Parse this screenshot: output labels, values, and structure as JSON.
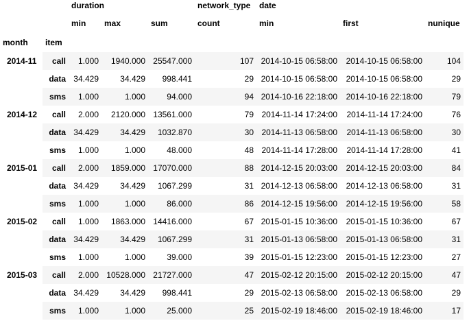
{
  "header": {
    "group1": [
      "duration",
      "network_type",
      "date"
    ],
    "group2": [
      "min",
      "max",
      "sum",
      "count",
      "min",
      "first",
      "nunique"
    ],
    "index_names": [
      "month",
      "item"
    ]
  },
  "rows": [
    {
      "month": "2014-11",
      "items": [
        {
          "item": "call",
          "cells": [
            "1.000",
            "1940.000",
            "25547.000",
            "107",
            "2014-10-15 06:58:00",
            "2014-10-15 06:58:00",
            "104"
          ]
        },
        {
          "item": "data",
          "cells": [
            "34.429",
            "34.429",
            "998.441",
            "29",
            "2014-10-15 06:58:00",
            "2014-10-15 06:58:00",
            "29"
          ]
        },
        {
          "item": "sms",
          "cells": [
            "1.000",
            "1.000",
            "94.000",
            "94",
            "2014-10-16 22:18:00",
            "2014-10-16 22:18:00",
            "79"
          ]
        }
      ]
    },
    {
      "month": "2014-12",
      "items": [
        {
          "item": "call",
          "cells": [
            "2.000",
            "2120.000",
            "13561.000",
            "79",
            "2014-11-14 17:24:00",
            "2014-11-14 17:24:00",
            "76"
          ]
        },
        {
          "item": "data",
          "cells": [
            "34.429",
            "34.429",
            "1032.870",
            "30",
            "2014-11-13 06:58:00",
            "2014-11-13 06:58:00",
            "30"
          ]
        },
        {
          "item": "sms",
          "cells": [
            "1.000",
            "1.000",
            "48.000",
            "48",
            "2014-11-14 17:28:00",
            "2014-11-14 17:28:00",
            "41"
          ]
        }
      ]
    },
    {
      "month": "2015-01",
      "items": [
        {
          "item": "call",
          "cells": [
            "2.000",
            "1859.000",
            "17070.000",
            "88",
            "2014-12-15 20:03:00",
            "2014-12-15 20:03:00",
            "84"
          ]
        },
        {
          "item": "data",
          "cells": [
            "34.429",
            "34.429",
            "1067.299",
            "31",
            "2014-12-13 06:58:00",
            "2014-12-13 06:58:00",
            "31"
          ]
        },
        {
          "item": "sms",
          "cells": [
            "1.000",
            "1.000",
            "86.000",
            "86",
            "2014-12-15 19:56:00",
            "2014-12-15 19:56:00",
            "58"
          ]
        }
      ]
    },
    {
      "month": "2015-02",
      "items": [
        {
          "item": "call",
          "cells": [
            "1.000",
            "1863.000",
            "14416.000",
            "67",
            "2015-01-15 10:36:00",
            "2015-01-15 10:36:00",
            "67"
          ]
        },
        {
          "item": "data",
          "cells": [
            "34.429",
            "34.429",
            "1067.299",
            "31",
            "2015-01-13 06:58:00",
            "2015-01-13 06:58:00",
            "31"
          ]
        },
        {
          "item": "sms",
          "cells": [
            "1.000",
            "1.000",
            "39.000",
            "39",
            "2015-01-15 12:23:00",
            "2015-01-15 12:23:00",
            "27"
          ]
        }
      ]
    },
    {
      "month": "2015-03",
      "items": [
        {
          "item": "call",
          "cells": [
            "2.000",
            "10528.000",
            "21727.000",
            "47",
            "2015-02-12 20:15:00",
            "2015-02-12 20:15:00",
            "47"
          ]
        },
        {
          "item": "data",
          "cells": [
            "34.429",
            "34.429",
            "998.441",
            "29",
            "2015-02-13 06:58:00",
            "2015-02-13 06:58:00",
            "29"
          ]
        },
        {
          "item": "sms",
          "cells": [
            "1.000",
            "1.000",
            "25.000",
            "25",
            "2015-02-19 18:46:00",
            "2015-02-19 18:46:00",
            "17"
          ]
        }
      ]
    }
  ]
}
